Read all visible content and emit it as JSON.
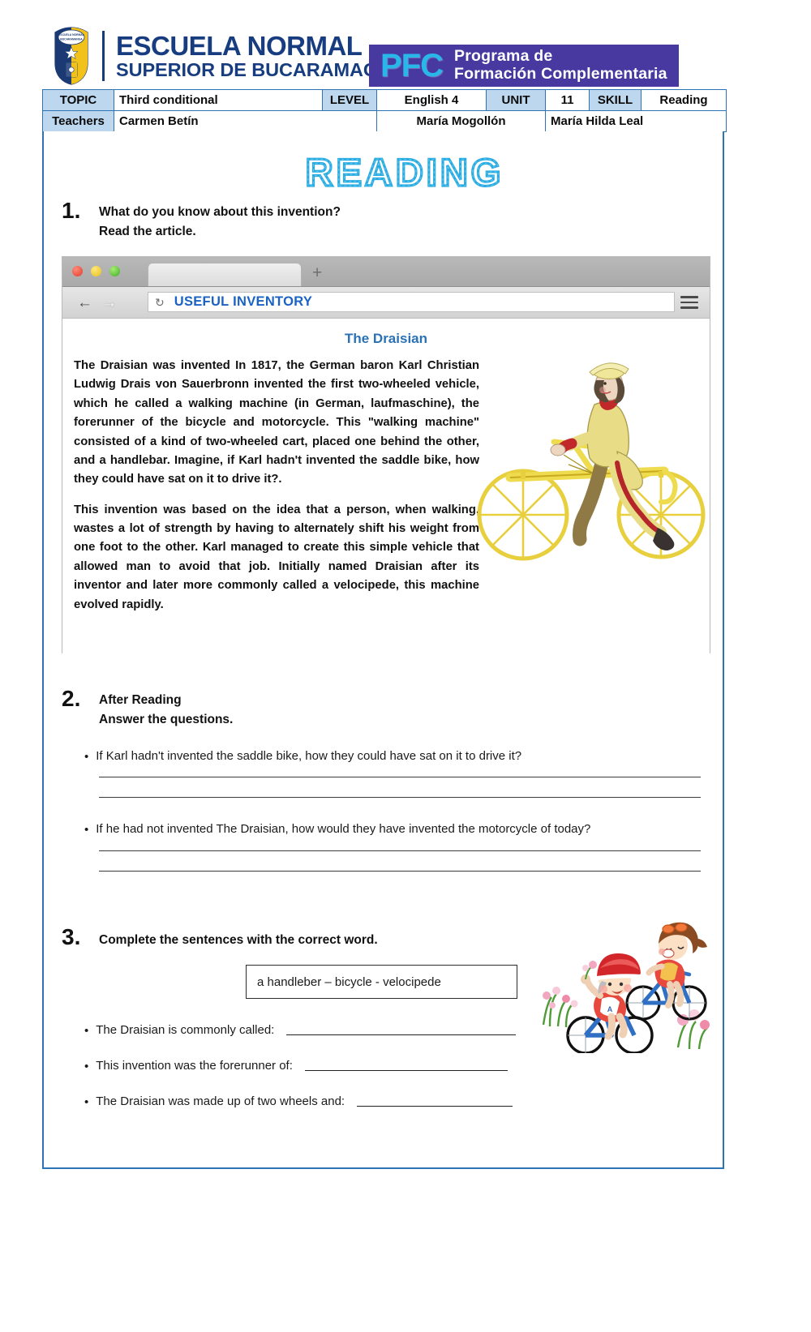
{
  "header": {
    "school_line1": "ESCUELA NORMAL",
    "school_line2": "SUPERIOR DE BUCARAMAGA",
    "logo_name": "school-crest-logo",
    "pfc_acronym": "PFC",
    "pfc_line1": "Programa de",
    "pfc_line2": "Formación Complementaria",
    "banner_color": "#4739a0",
    "acronym_color": "#29b6e8",
    "school_text_color": "#173d80"
  },
  "info_table": {
    "row1": [
      {
        "label": "TOPIC",
        "value": "Third conditional"
      },
      {
        "label": "LEVEL",
        "value": "English 4"
      },
      {
        "label": "UNIT",
        "value": "11"
      },
      {
        "label": "SKILL",
        "value": "Reading"
      }
    ],
    "row2": {
      "label": "Teachers",
      "teacher1": "Carmen Betín",
      "teacher2": "María Mogollón",
      "teacher3": "María Hilda Leal"
    }
  },
  "page_title": "READING",
  "title_color": "#29abe2",
  "exercise1": {
    "number": "1.",
    "line1": "What do you know about this invention?",
    "line2": "Read the article."
  },
  "browser": {
    "url_text": "USEFUL INVENTORY",
    "url_color": "#1a62c4",
    "reload_icon": "reload-icon",
    "back_icon": "back-arrow-icon",
    "forward_icon": "forward-arrow-icon",
    "menu_icon": "hamburger-menu-icon",
    "new_tab_icon": "plus-icon",
    "traffic_lights": [
      "close-red-dot",
      "minimize-yellow-dot",
      "maximize-green-dot"
    ]
  },
  "article": {
    "title": "The Draisian",
    "title_color": "#2a72b5",
    "paragraph1": "The Draisian was invented In 1817, the German baron Karl Christian Ludwig Drais von Sauerbronn invented the first two-wheeled vehicle, which he called a walking machine (in German, laufmaschine), the forerunner of the bicycle and motorcycle. This \"walking machine\" consisted of a kind of two-wheeled cart, placed one behind the other, and a handlebar. Imagine, if Karl hadn't invented the saddle bike, how they could have sat on it to drive it?.",
    "paragraph2": "This invention was based on the idea that a person, when walking, wastes a lot of strength by having to alternately shift his weight from one foot to the other. Karl managed to create this simple vehicle that allowed man to avoid that job. Initially named Draisian after its inventor and later more commonly called a velocipede, this machine evolved rapidly.",
    "illustration": "vintage-draisine-rider-illustration"
  },
  "exercise2": {
    "number": "2.",
    "line1": "After Reading",
    "line2": "Answer the questions.",
    "questions": [
      "If Karl hadn't invented the saddle bike, how they could have sat on it to drive it?",
      "If he had not invented The Draisian, how would they have invented the motorcycle of today?"
    ]
  },
  "exercise3": {
    "number": "3.",
    "instruction": "Complete the sentences with the correct word.",
    "word_bank": "a handleber – bicycle - velocipede",
    "illustration": "kids-riding-bicycles-clipart",
    "sentences": [
      "The Draisian is commonly called:",
      "This invention was the forerunner of:",
      "The Draisian was made up of two wheels and:"
    ]
  }
}
